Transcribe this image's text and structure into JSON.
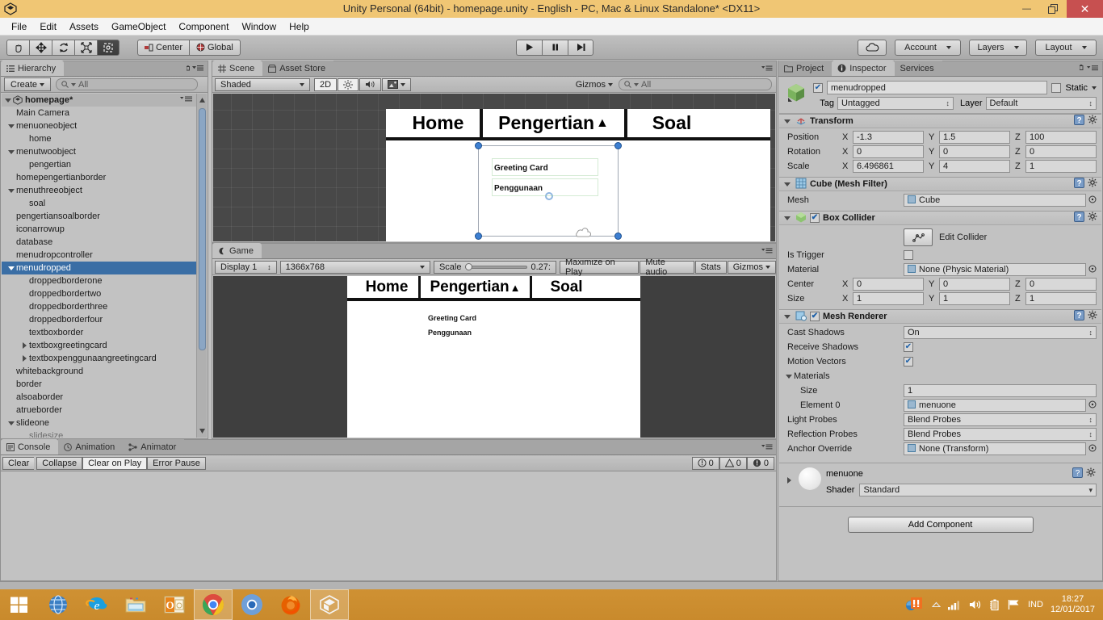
{
  "window": {
    "title": "Unity Personal (64bit) - homepage.unity - English - PC, Mac & Linux Standalone* <DX11>",
    "minimize_label": "–",
    "restore_label": "❐",
    "close_label": "✕"
  },
  "menubar": {
    "items": [
      "File",
      "Edit",
      "Assets",
      "GameObject",
      "Component",
      "Window",
      "Help"
    ]
  },
  "toolbar": {
    "tools": [
      {
        "name": "hand-tool",
        "icon": "hand-icon",
        "active": false
      },
      {
        "name": "move-tool",
        "icon": "move-icon",
        "active": false
      },
      {
        "name": "rotate-tool",
        "icon": "rotate-icon",
        "active": false
      },
      {
        "name": "scale-tool",
        "icon": "scale-icon",
        "active": false
      },
      {
        "name": "rect-tool",
        "icon": "rect-icon",
        "active": true
      }
    ],
    "pivot_mode": "Center",
    "pivot_rotation": "Global",
    "play": "▶",
    "pause": "❙❙",
    "step": "▶❙",
    "cloud_label": "cloud-icon",
    "account": "Account",
    "layers": "Layers",
    "layout": "Layout"
  },
  "hierarchy": {
    "tab": "Hierarchy",
    "create_button": "Create",
    "search_placeholder": "All",
    "scene_name": "homepage*",
    "items": [
      {
        "label": "Main Camera",
        "depth": 1,
        "foldout": "none"
      },
      {
        "label": "menuoneobject",
        "depth": 1,
        "foldout": "open"
      },
      {
        "label": "home",
        "depth": 2,
        "foldout": "none"
      },
      {
        "label": "menutwoobject",
        "depth": 1,
        "foldout": "open"
      },
      {
        "label": "pengertian",
        "depth": 2,
        "foldout": "none"
      },
      {
        "label": "homepengertianborder",
        "depth": 1,
        "foldout": "none"
      },
      {
        "label": "menuthreeobject",
        "depth": 1,
        "foldout": "open"
      },
      {
        "label": "soal",
        "depth": 2,
        "foldout": "none"
      },
      {
        "label": "pengertiansoalborder",
        "depth": 1,
        "foldout": "none"
      },
      {
        "label": "iconarrowup",
        "depth": 1,
        "foldout": "none"
      },
      {
        "label": "database",
        "depth": 1,
        "foldout": "none"
      },
      {
        "label": "menudropcontroller",
        "depth": 1,
        "foldout": "none"
      },
      {
        "label": "menudropped",
        "depth": 1,
        "foldout": "open",
        "selected": true
      },
      {
        "label": "droppedborderone",
        "depth": 2,
        "foldout": "none"
      },
      {
        "label": "droppedbordertwo",
        "depth": 2,
        "foldout": "none"
      },
      {
        "label": "droppedborderthree",
        "depth": 2,
        "foldout": "none"
      },
      {
        "label": "droppedborderfour",
        "depth": 2,
        "foldout": "none"
      },
      {
        "label": "textboxborder",
        "depth": 2,
        "foldout": "none"
      },
      {
        "label": "textboxgreetingcard",
        "depth": 2,
        "foldout": "closed"
      },
      {
        "label": "textboxpenggunaangreetingcard",
        "depth": 2,
        "foldout": "closed"
      },
      {
        "label": "whitebackground",
        "depth": 1,
        "foldout": "none"
      },
      {
        "label": "border",
        "depth": 1,
        "foldout": "none"
      },
      {
        "label": "alsoaborder",
        "depth": 1,
        "foldout": "none"
      },
      {
        "label": "atrueborder",
        "depth": 1,
        "foldout": "none"
      },
      {
        "label": "slideone",
        "depth": 1,
        "foldout": "open"
      },
      {
        "label": "slidesize",
        "depth": 2,
        "foldout": "none",
        "dim": true
      }
    ]
  },
  "scene": {
    "tabs": [
      {
        "label": "Scene",
        "icon": "grid-icon",
        "active": true
      },
      {
        "label": "Asset Store",
        "icon": "store-icon",
        "active": false
      }
    ],
    "draw_mode": "Shaded",
    "mode_2d": "2D",
    "lighting_icon": "sun-icon",
    "audio_icon": "speaker-icon",
    "fx_icon": "image-icon",
    "gizmos": "Gizmos",
    "search_placeholder": "All",
    "content": {
      "menu_items": [
        "Home",
        "Pengertian",
        "Soal"
      ],
      "dropdown_arrow": "▲",
      "dropped_items": [
        "Greeting Card",
        "Penggunaan"
      ]
    }
  },
  "game": {
    "tab": "Game",
    "display": "Display 1",
    "resolution": "1366x768",
    "scale_label": "Scale",
    "scale_value": "0.27:",
    "maximize_on_play": "Maximize on Play",
    "mute_audio": "Mute audio",
    "stats": "Stats",
    "gizmos": "Gizmos",
    "content": {
      "menu_items": [
        "Home",
        "Pengertian",
        "Soal"
      ],
      "dropdown_arrow": "▲",
      "dropped_items": [
        "Greeting Card",
        "Penggunaan"
      ]
    }
  },
  "inspector": {
    "tabs": [
      {
        "label": "Project",
        "icon": "folder-icon",
        "active": false
      },
      {
        "label": "Inspector",
        "icon": "info-icon",
        "active": true
      },
      {
        "label": "Services",
        "icon": "services-icon",
        "active": false
      }
    ],
    "object_name": "menudropped",
    "object_enabled": true,
    "static_label": "Static",
    "tag_label": "Tag",
    "tag_value": "Untagged",
    "layer_label": "Layer",
    "layer_value": "Default",
    "components": [
      {
        "name": "Transform",
        "icon": "transform-icon",
        "rows": [
          {
            "label": "Position",
            "type": "vector3",
            "x": "-1.3",
            "y": "1.5",
            "z": "100"
          },
          {
            "label": "Rotation",
            "type": "vector3",
            "x": "0",
            "y": "0",
            "z": "0"
          },
          {
            "label": "Scale",
            "type": "vector3",
            "x": "6.496861",
            "y": "4",
            "z": "1"
          }
        ]
      },
      {
        "name": "Cube (Mesh Filter)",
        "icon": "meshfilter-icon",
        "rows": [
          {
            "label": "Mesh",
            "type": "object",
            "value": "Cube"
          }
        ]
      },
      {
        "name": "Box Collider",
        "icon": "boxcollider-icon",
        "has_toggle": true,
        "toggle_on": true,
        "rows": [
          {
            "label": "",
            "type": "editcollider",
            "value": "Edit Collider"
          },
          {
            "label": "Is Trigger",
            "type": "checkbox",
            "checked": false
          },
          {
            "label": "Material",
            "type": "object",
            "value": "None (Physic Material)"
          },
          {
            "label": "Center",
            "type": "vector3",
            "x": "0",
            "y": "0",
            "z": "0"
          },
          {
            "label": "Size",
            "type": "vector3",
            "x": "1",
            "y": "1",
            "z": "1"
          }
        ]
      },
      {
        "name": "Mesh Renderer",
        "icon": "meshrenderer-icon",
        "has_toggle": true,
        "toggle_on": true,
        "rows": [
          {
            "label": "Cast Shadows",
            "type": "popup",
            "value": "On"
          },
          {
            "label": "Receive Shadows",
            "type": "checkbox",
            "checked": true
          },
          {
            "label": "Motion Vectors",
            "type": "checkbox",
            "checked": true
          },
          {
            "label": "Materials",
            "type": "foldout"
          },
          {
            "label": "Size",
            "type": "text",
            "value": "1",
            "indent": 1
          },
          {
            "label": "Element 0",
            "type": "object",
            "value": "menuone",
            "indent": 1
          },
          {
            "label": "Light Probes",
            "type": "popup",
            "value": "Blend Probes"
          },
          {
            "label": "Reflection Probes",
            "type": "popup",
            "value": "Blend Probes"
          },
          {
            "label": "Anchor Override",
            "type": "object",
            "value": "None (Transform)"
          }
        ]
      }
    ],
    "material": {
      "name": "menuone",
      "shader_label": "Shader",
      "shader_value": "Standard"
    },
    "add_component": "Add Component"
  },
  "console": {
    "tabs": [
      {
        "label": "Console",
        "icon": "console-icon",
        "active": true
      },
      {
        "label": "Animation",
        "icon": "clock-icon",
        "active": false
      },
      {
        "label": "Animator",
        "icon": "animator-icon",
        "active": false
      }
    ],
    "clear": "Clear",
    "collapse": "Collapse",
    "clear_on_play": "Clear on Play",
    "error_pause": "Error Pause",
    "counts": {
      "info": "0",
      "warning": "0",
      "error": "0"
    }
  },
  "taskbar": {
    "items": [
      {
        "name": "start-button",
        "icon": "windows-icon"
      },
      {
        "name": "taskbar-item-globe",
        "icon": "globe-icon"
      },
      {
        "name": "taskbar-item-ie",
        "icon": "internet-explorer-icon"
      },
      {
        "name": "taskbar-item-explorer",
        "icon": "file-explorer-icon"
      },
      {
        "name": "taskbar-item-outlook",
        "icon": "outlook-icon"
      },
      {
        "name": "taskbar-item-chrome",
        "icon": "chrome-icon",
        "active": true
      },
      {
        "name": "taskbar-item-chromium",
        "icon": "chromium-icon"
      },
      {
        "name": "taskbar-item-firefox",
        "icon": "firefox-icon"
      },
      {
        "name": "taskbar-item-unity",
        "icon": "unity-icon",
        "active": true
      }
    ],
    "tray": {
      "alert_icon": "alert-icon",
      "show_hidden_icon": "chevron-up-icon",
      "network_icon": "wifi-icon",
      "volume_icon": "speaker-icon",
      "battery_icon": "battery-icon",
      "action_icon": "flag-icon",
      "language": "IND",
      "time": "18:27",
      "date": "12/01/2017"
    }
  },
  "colors": {
    "title_bar": "#f0c674",
    "taskbar": "#cf9133",
    "selection_blue": "#3a6ea5",
    "close_red": "#c75050",
    "panel_gray": "#c2c2c2",
    "scene_bg": "#484848"
  }
}
